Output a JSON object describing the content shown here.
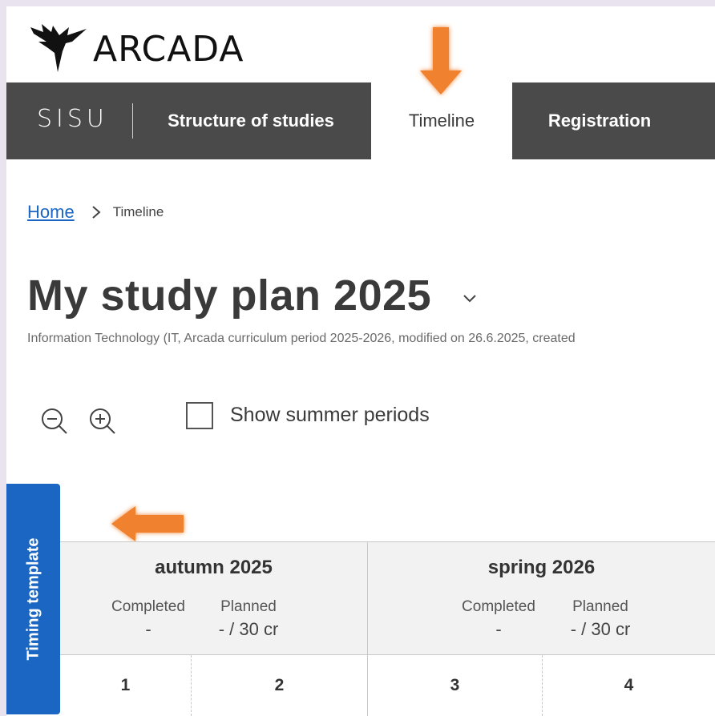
{
  "brand": {
    "logo_text": "ARCADA",
    "app_name": "SISU"
  },
  "nav": {
    "items": [
      {
        "label": "Structure of studies",
        "active": false
      },
      {
        "label": "Timeline",
        "active": true
      },
      {
        "label": "Registration",
        "active": false
      }
    ]
  },
  "breadcrumb": {
    "home": "Home",
    "current": "Timeline"
  },
  "plan": {
    "title": "My study plan 2025",
    "subtitle": "Information Technology (IT, Arcada curriculum period 2025-2026, modified on 26.6.2025, created"
  },
  "controls": {
    "zoom_out_icon": "zoom-out-icon",
    "zoom_in_icon": "zoom-in-icon",
    "show_summer_label": "Show summer periods",
    "show_summer_checked": false
  },
  "timing_tab": {
    "label": "Timing template"
  },
  "timeline": {
    "terms": [
      {
        "title": "autumn 2025",
        "completed_label": "Completed",
        "completed_value": "-",
        "planned_label": "Planned",
        "planned_value": "- / 30 cr"
      },
      {
        "title": "spring 2026",
        "completed_label": "Completed",
        "completed_value": "-",
        "planned_label": "Planned",
        "planned_value": "- / 30 cr"
      }
    ],
    "periods": [
      "1",
      "2",
      "3",
      "4"
    ]
  },
  "colors": {
    "nav_dark": "#4a4a4a",
    "accent_blue": "#1a66c2",
    "annotation_arrow": "#f0812f",
    "page_border": "#e9e3ef"
  }
}
